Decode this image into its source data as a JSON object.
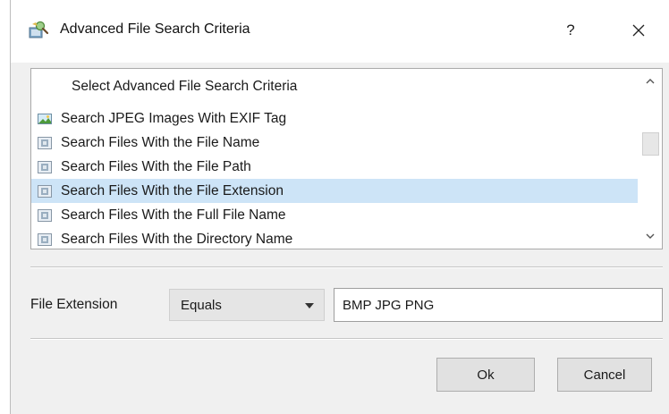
{
  "window": {
    "title": "Advanced File Search Criteria",
    "icon": "app-search-icon",
    "help_label": "?",
    "close_icon": "close-icon"
  },
  "criteria_list": {
    "header": "Select Advanced File Search Criteria",
    "items": [
      {
        "label": "Search JPEG Images With EXIF Tag",
        "icon": "image-icon",
        "selected": false
      },
      {
        "label": "Search Files With the File Name",
        "icon": "file-criteria-icon",
        "selected": false
      },
      {
        "label": "Search Files With the File Path",
        "icon": "file-criteria-icon",
        "selected": false
      },
      {
        "label": "Search Files With the File Extension",
        "icon": "file-criteria-icon",
        "selected": true
      },
      {
        "label": "Search Files With the Full File Name",
        "icon": "file-criteria-icon",
        "selected": false
      },
      {
        "label": "Search Files With the Directory Name",
        "icon": "file-criteria-icon",
        "selected": false
      }
    ]
  },
  "criteria_editor": {
    "field_label": "File Extension",
    "operator_value": "Equals",
    "value_text": "BMP JPG PNG"
  },
  "buttons": {
    "ok_label": "Ok",
    "cancel_label": "Cancel"
  },
  "colors": {
    "selection": "#cde4f7",
    "dialog_bg": "#f0f0f0",
    "button_bg": "#e1e1e1"
  }
}
